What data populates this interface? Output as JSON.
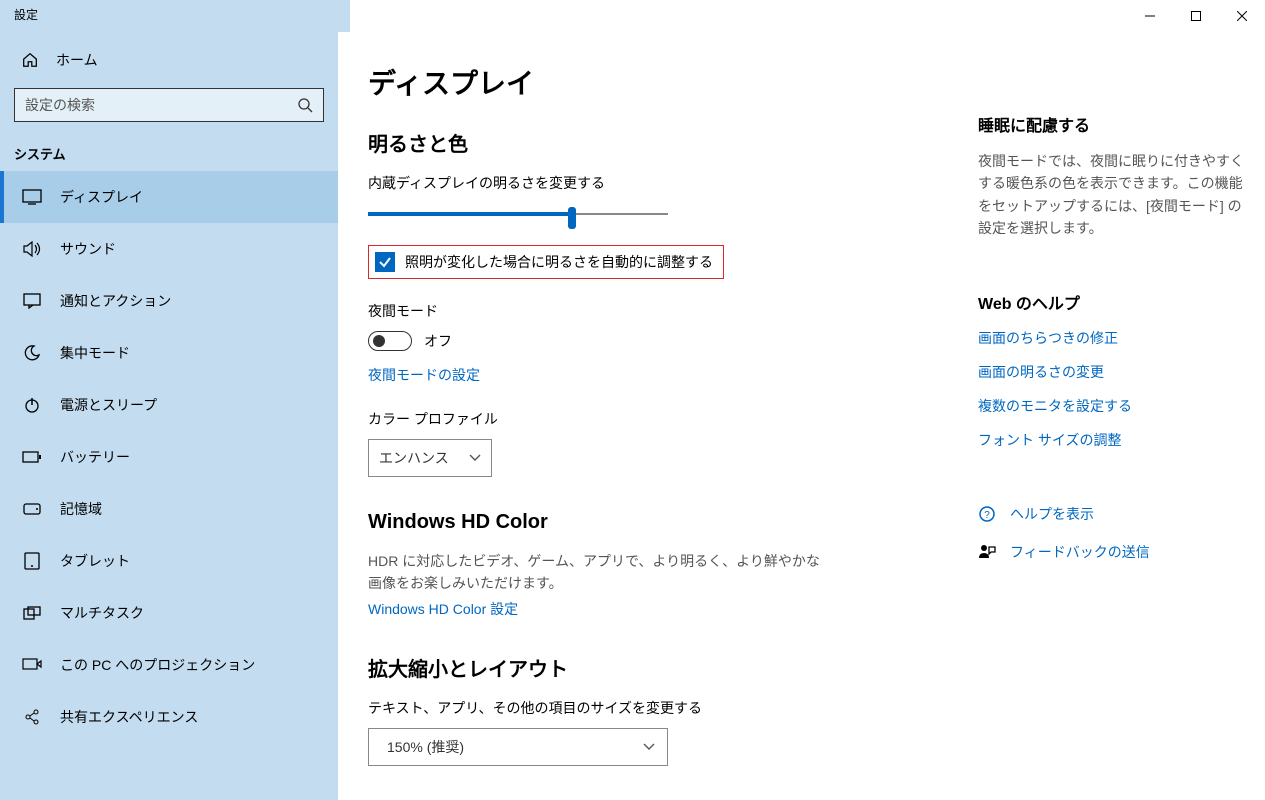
{
  "window": {
    "title": "設定"
  },
  "sidebar": {
    "home": "ホーム",
    "search_placeholder": "設定の検索",
    "category": "システム",
    "items": [
      {
        "label": "ディスプレイ"
      },
      {
        "label": "サウンド"
      },
      {
        "label": "通知とアクション"
      },
      {
        "label": "集中モード"
      },
      {
        "label": "電源とスリープ"
      },
      {
        "label": "バッテリー"
      },
      {
        "label": "記憶域"
      },
      {
        "label": "タブレット"
      },
      {
        "label": "マルチタスク"
      },
      {
        "label": "この PC へのプロジェクション"
      },
      {
        "label": "共有エクスペリエンス"
      }
    ]
  },
  "main": {
    "title": "ディスプレイ",
    "brightness": {
      "heading": "明るさと色",
      "slider_label": "内蔵ディスプレイの明るさを変更する",
      "slider_percent": 68,
      "auto_checkbox": "照明が変化した場合に明るさを自動的に調整する",
      "auto_checked": true,
      "night_label": "夜間モード",
      "night_state": "オフ",
      "night_link": "夜間モードの設定",
      "profile_label": "カラー プロファイル",
      "profile_value": "エンハンス"
    },
    "hdcolor": {
      "heading": "Windows HD Color",
      "desc": "HDR に対応したビデオ、ゲーム、アプリで、より明るく、より鮮やかな画像をお楽しみいただけます。",
      "link": "Windows HD Color 設定"
    },
    "scale": {
      "heading": "拡大縮小とレイアウト",
      "label": "テキスト、アプリ、その他の項目のサイズを変更する",
      "value": "150% (推奨)"
    }
  },
  "aside": {
    "sleep": {
      "heading": "睡眠に配慮する",
      "desc": "夜間モードでは、夜間に眠りに付きやすくする暖色系の色を表示できます。この機能をセットアップするには、[夜間モード] の設定を選択します。"
    },
    "webhelp": {
      "heading": "Web のヘルプ",
      "links": [
        "画面のちらつきの修正",
        "画面の明るさの変更",
        "複数のモニタを設定する",
        "フォント サイズの調整"
      ]
    },
    "help_row": "ヘルプを表示",
    "feedback_row": "フィードバックの送信"
  }
}
